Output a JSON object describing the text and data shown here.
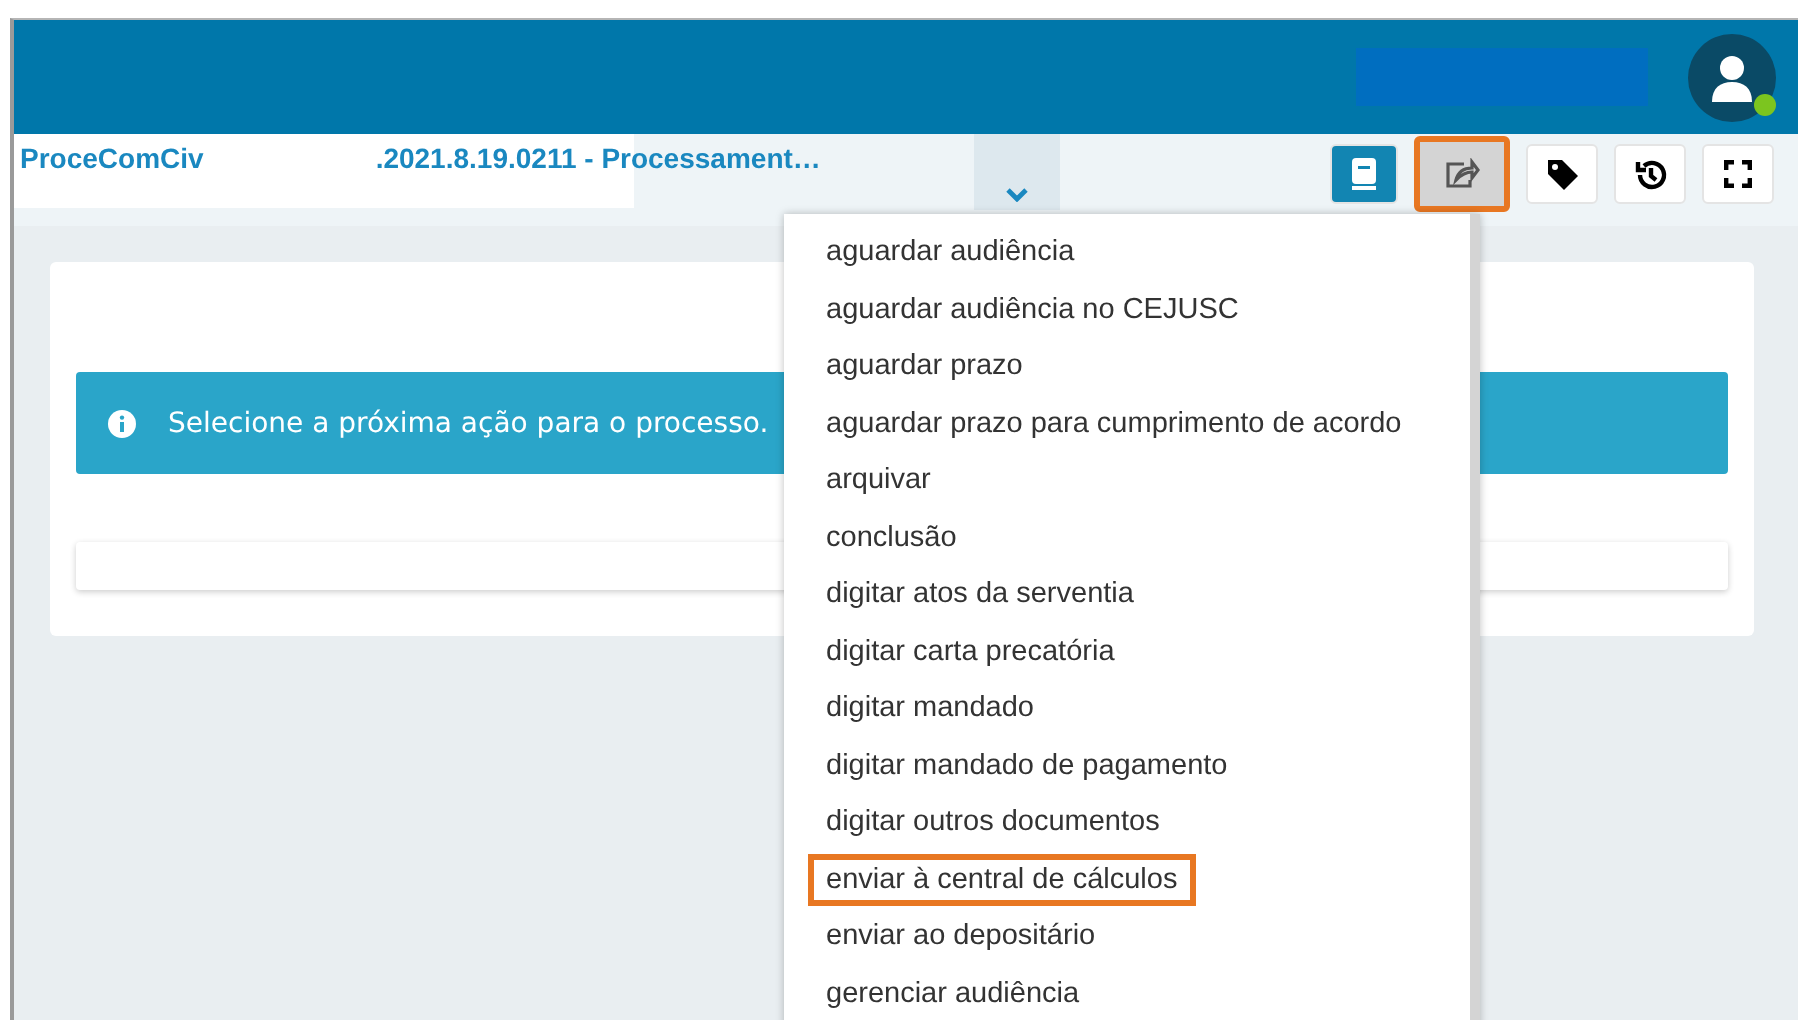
{
  "header": {
    "user_online": true
  },
  "subheader": {
    "system": "ProceComCiv",
    "process": ".2021.8.19.0211 - Processament…"
  },
  "toolbar": [
    {
      "kind": "book",
      "selected": true,
      "highlighted": false
    },
    {
      "kind": "share",
      "selected": false,
      "highlighted": true
    },
    {
      "kind": "tag",
      "selected": false,
      "highlighted": false
    },
    {
      "kind": "history",
      "selected": false,
      "highlighted": false
    },
    {
      "kind": "fullscreen",
      "selected": false,
      "highlighted": false
    }
  ],
  "alert": {
    "text": "Selecione a próxima ação para o processo."
  },
  "menu": [
    {
      "label": "aguardar audiência",
      "highlighted": false
    },
    {
      "label": "aguardar audiência no CEJUSC",
      "highlighted": false
    },
    {
      "label": "aguardar prazo",
      "highlighted": false
    },
    {
      "label": "aguardar prazo para cumprimento de acordo",
      "highlighted": false
    },
    {
      "label": "arquivar",
      "highlighted": false
    },
    {
      "label": "conclusão",
      "highlighted": false
    },
    {
      "label": "digitar atos da serventia",
      "highlighted": false
    },
    {
      "label": "digitar carta precatória",
      "highlighted": false
    },
    {
      "label": "digitar mandado",
      "highlighted": false
    },
    {
      "label": "digitar mandado de pagamento",
      "highlighted": false
    },
    {
      "label": "digitar outros documentos",
      "highlighted": false
    },
    {
      "label": "enviar à central de cálculos",
      "highlighted": true
    },
    {
      "label": "enviar ao depositário",
      "highlighted": false
    },
    {
      "label": "gerenciar audiência",
      "highlighted": false
    }
  ]
}
